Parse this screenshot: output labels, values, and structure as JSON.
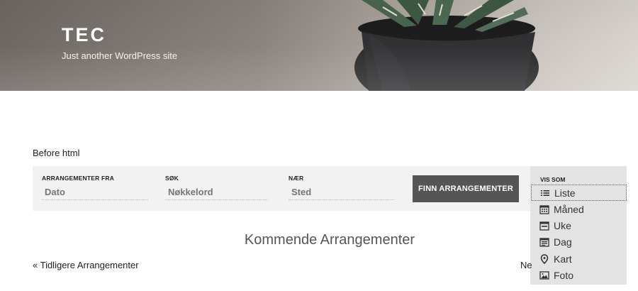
{
  "site": {
    "title": "TEC",
    "description": "Just another WordPress site"
  },
  "before_html": "Before html",
  "search_bar": {
    "from_label": "ARRANGEMENTER FRA",
    "from_placeholder": "Dato",
    "search_label": "SØK",
    "search_placeholder": "Nøkkelord",
    "near_label": "NÆR",
    "near_placeholder": "Sted",
    "find_button": "FINN ARRANGEMENTER"
  },
  "view_as": {
    "label": "VIS SOM",
    "options": [
      {
        "label": "Liste",
        "icon": "list-icon",
        "selected": true
      },
      {
        "label": "Måned",
        "icon": "calendar-month-icon"
      },
      {
        "label": "Uke",
        "icon": "calendar-week-icon"
      },
      {
        "label": "Dag",
        "icon": "calendar-day-icon"
      },
      {
        "label": "Kart",
        "icon": "map-pin-icon"
      },
      {
        "label": "Foto",
        "icon": "photo-icon"
      }
    ]
  },
  "main": {
    "heading": "Kommende Arrangementer",
    "prev_link": "« Tidligere Arrangementer",
    "next_link": "Ne"
  }
}
